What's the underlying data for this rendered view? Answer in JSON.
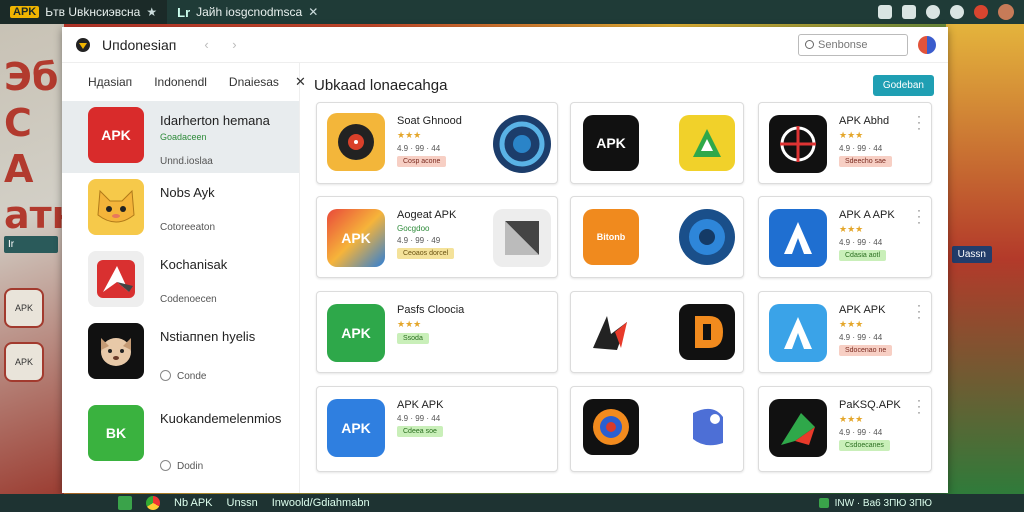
{
  "browser": {
    "tabs": [
      {
        "logo": "APK",
        "title": "Ьтв Uвkнсиэвсна",
        "close": "★"
      },
      {
        "logo": "Lr",
        "title": "Jайh iosgcnodmsca",
        "close": "✕"
      }
    ]
  },
  "wallpaper": {
    "big_text": "Эб\nC\nA\nатн",
    "tag_left": "Ir",
    "tag_right": "Uassn",
    "icons": [
      "APK",
      "APK"
    ]
  },
  "window": {
    "title": "Uпdonesiaп",
    "nav": "‹ ›",
    "search_placeholder": "Sеnbonse",
    "content_title": "Ubkaad lonaecahga",
    "cta_label": "Godeban"
  },
  "sidebar": {
    "tabs": [
      "Ндаsiaп",
      "Indonendl",
      "Dnaiesas"
    ],
    "close": "✕",
    "items": [
      {
        "icon": "APK",
        "name": "Idarhertоn hemana",
        "sub": "Goadaceen",
        "sub2": "Unnd.ioslaa"
      },
      {
        "icon": "",
        "name": "Nobs Ayk",
        "sub": "Cotoreeaton"
      },
      {
        "icon": "",
        "name": "Kochanisak",
        "sub": "Codenoecen"
      },
      {
        "icon": "",
        "name": "Nstiaпnen hyelis",
        "sub": "Conde"
      },
      {
        "icon": "BK",
        "name": "Kuokandemelenmios",
        "sub": "Dodin"
      }
    ]
  },
  "cards": [
    {
      "icon_a": "",
      "name": "Soat Ghnood",
      "stars": "★★★",
      "green": "",
      "stats": "4.9 · 99 · 44",
      "badge": "Cosp acone",
      "badge_color": "pink"
    },
    {
      "icon_a": "APK",
      "name": "",
      "stars": "",
      "green": "",
      "stats": "",
      "badge": "",
      "badge_color": ""
    },
    {
      "icon_a": "",
      "name": "APK Abhd",
      "stars": "★★★",
      "green": "",
      "stats": "4.9 · 99 · 44",
      "badge": "Sdeecho sae",
      "badge_color": "pink"
    },
    {
      "icon_a": "APK",
      "name": "Aogeat APK",
      "stars": "",
      "green": "Gocgdoo",
      "stats": "4.9 · 99 · 49",
      "badge": "Ceoaos dorcel",
      "badge_color": "yellow"
    },
    {
      "icon_a": "Bitonb",
      "name": "",
      "stars": "",
      "green": "",
      "stats": "",
      "badge": "",
      "badge_color": ""
    },
    {
      "icon_a": "",
      "name": "APK A APK",
      "stars": "★★★",
      "green": "",
      "stats": "4.9 · 99 · 44",
      "badge": "Cdasia aotl",
      "badge_color": "green"
    },
    {
      "icon_a": "APK",
      "name": "Pasfs Cloocia",
      "stars": "★★★",
      "green": "",
      "stats": "",
      "badge": "Ssoda",
      "badge_color": "green"
    },
    {
      "icon_a": "",
      "name": "",
      "stars": "",
      "green": "",
      "stats": "",
      "badge": "",
      "badge_color": ""
    },
    {
      "icon_a": "",
      "name": "APK APK",
      "stars": "★★★",
      "green": "",
      "stats": "4.9 · 99 · 44",
      "badge": "Sdocenao ne",
      "badge_color": "pink"
    },
    {
      "icon_a": "APK",
      "name": "APK APK",
      "stars": "",
      "green": "",
      "stats": "4.9 · 99 · 44",
      "badge": "Cdeea soe",
      "badge_color": "green"
    },
    {
      "icon_a": "",
      "name": "",
      "stars": "",
      "green": "",
      "stats": "",
      "badge": "",
      "badge_color": ""
    },
    {
      "icon_a": "",
      "name": "PaKSQ.APK",
      "stars": "★★★",
      "green": "",
      "stats": "4.9 · 99 · 44",
      "badge": "Csdoecanes",
      "badge_color": "green"
    }
  ],
  "taskbar": {
    "items": [
      "",
      "",
      "Nb APK",
      "Unssn",
      "Inwoold/Gdiahmabn"
    ],
    "tray": "INW · Ba6 3ПЮ 3ПЮ"
  }
}
